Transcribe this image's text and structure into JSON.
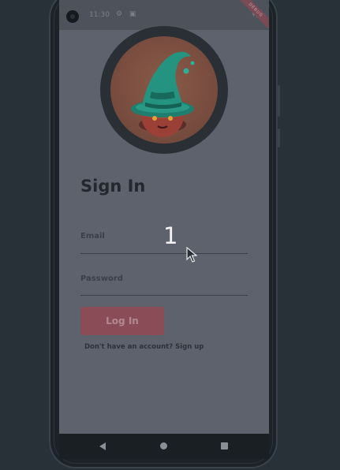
{
  "status_bar": {
    "time": "11:30",
    "icons": "⚙ ▣",
    "right_icons": "▾◢"
  },
  "debug_banner": "DEBUG",
  "app": {
    "avatar_icon": "witch-hat-icon",
    "title": "Sign In",
    "email": {
      "label": "Email"
    },
    "password": {
      "label": "Password"
    },
    "login_button": "Log In",
    "signup_link": "Don't have an account? Sign up"
  },
  "nav_bar": {
    "back_icon": "back-triangle-icon",
    "home_icon": "home-circle-icon",
    "recents_icon": "recents-square-icon"
  },
  "overlay": {
    "step_number": "1"
  },
  "colors": {
    "background": "#283038",
    "screen": "#5e626c",
    "button": "#8a4d58",
    "title": "#23282f"
  }
}
